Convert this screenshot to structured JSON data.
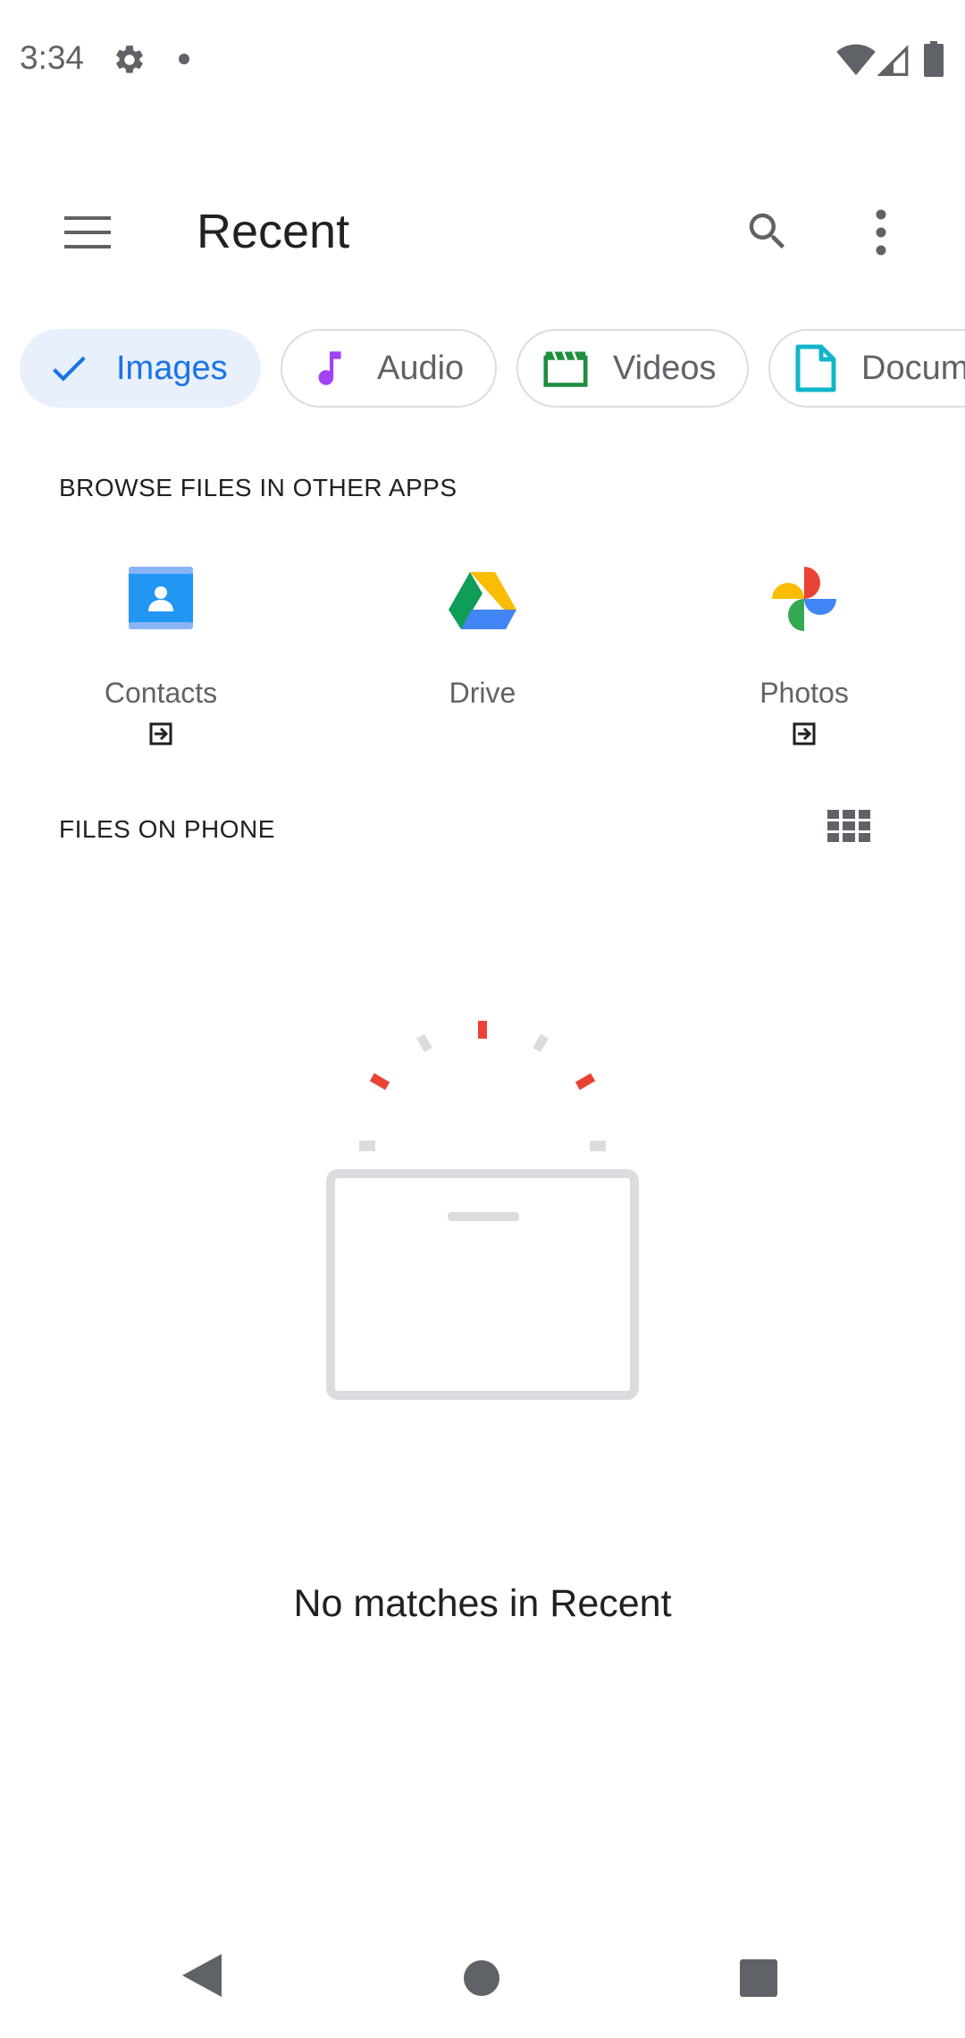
{
  "status_bar": {
    "time": "3:34",
    "left_icons": [
      "settings-icon",
      "notification-dot-icon"
    ],
    "right_icons": [
      "wifi-icon",
      "cell-signal-icon",
      "battery-icon"
    ]
  },
  "app_bar": {
    "title": "Recent",
    "icons": [
      "menu-icon",
      "search-icon",
      "more-vert-icon"
    ]
  },
  "chips": [
    {
      "label": "Images",
      "icon": "check-icon",
      "selected": true
    },
    {
      "label": "Audio",
      "icon": "music-note-icon",
      "selected": false
    },
    {
      "label": "Videos",
      "icon": "movie-icon",
      "selected": false
    },
    {
      "label": "Documents",
      "icon": "document-icon",
      "selected": false
    }
  ],
  "browse_section": {
    "header": "BROWSE FILES IN OTHER APPS",
    "apps": [
      {
        "label": "Contacts",
        "icon": "contacts-icon",
        "external": true
      },
      {
        "label": "Drive",
        "icon": "drive-icon",
        "external": false
      },
      {
        "label": "Photos",
        "icon": "photos-icon",
        "external": true
      }
    ]
  },
  "files_section": {
    "header": "FILES ON PHONE",
    "view_toggle_icon": "grid-view-icon"
  },
  "empty_state": {
    "message": "No matches in Recent",
    "illustration": "empty-box-icon"
  },
  "nav_bar": {
    "icons": [
      "back-icon",
      "home-icon",
      "recents-icon"
    ]
  },
  "colors": {
    "accent": "#1a73e8",
    "chip_selected_bg": "#e8f0fe",
    "chip_border": "#dadce0",
    "text_secondary": "#5f6368"
  }
}
